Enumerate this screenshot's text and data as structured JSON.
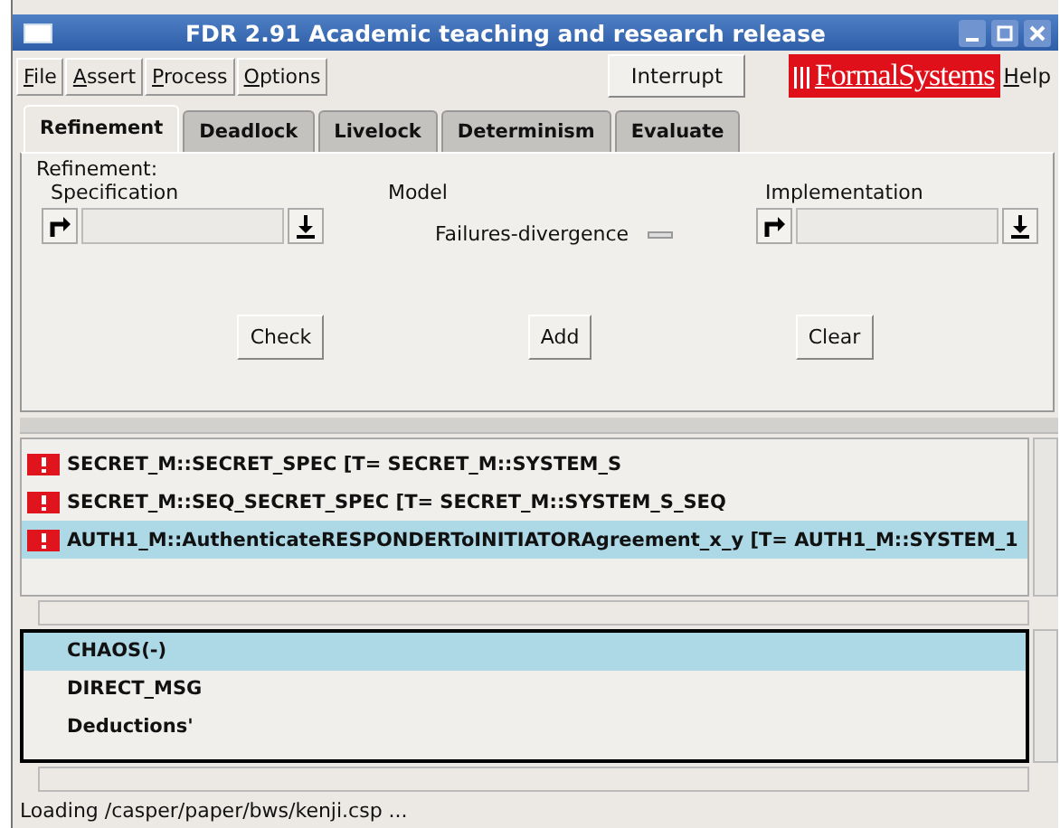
{
  "window": {
    "title": "FDR 2.91 Academic teaching and research release"
  },
  "menu": [
    {
      "underline": "F",
      "rest": "ile"
    },
    {
      "underline": "A",
      "rest": "ssert"
    },
    {
      "underline": "P",
      "rest": "rocess"
    },
    {
      "underline": "O",
      "rest": "ptions"
    }
  ],
  "interrupt_button": "Interrupt",
  "logo": "FormalSystems",
  "help_menu": {
    "underline": "H",
    "rest": "elp"
  },
  "tabs": [
    {
      "label": "Refinement",
      "selected": true
    },
    {
      "label": "Deadlock",
      "selected": false
    },
    {
      "label": "Livelock",
      "selected": false
    },
    {
      "label": "Determinism",
      "selected": false
    },
    {
      "label": "Evaluate",
      "selected": false
    }
  ],
  "panel": {
    "title": "Refinement:",
    "specification_label": "Specification",
    "model_label": "Model",
    "model_value": "Failures-divergence",
    "implementation_label": "Implementation",
    "buttons": [
      "Check",
      "Add",
      "Clear"
    ]
  },
  "assertions": [
    {
      "text": "SECRET_M::SECRET_SPEC [T= SECRET_M::SYSTEM_S",
      "selected": false
    },
    {
      "text": "SECRET_M::SEQ_SECRET_SPEC [T= SECRET_M::SYSTEM_S_SEQ",
      "selected": false
    },
    {
      "text": "AUTH1_M::AuthenticateRESPONDERToINITIATORAgreement_x_y [T= AUTH1_M::SYSTEM_1",
      "selected": true
    }
  ],
  "processes": [
    {
      "text": "CHAOS(-)",
      "selected": true
    },
    {
      "text": "DIRECT_MSG",
      "selected": false
    },
    {
      "text": "Deductions'",
      "selected": false
    }
  ],
  "status_bar": "Loading /casper/paper/bws/kenji.csp ..."
}
